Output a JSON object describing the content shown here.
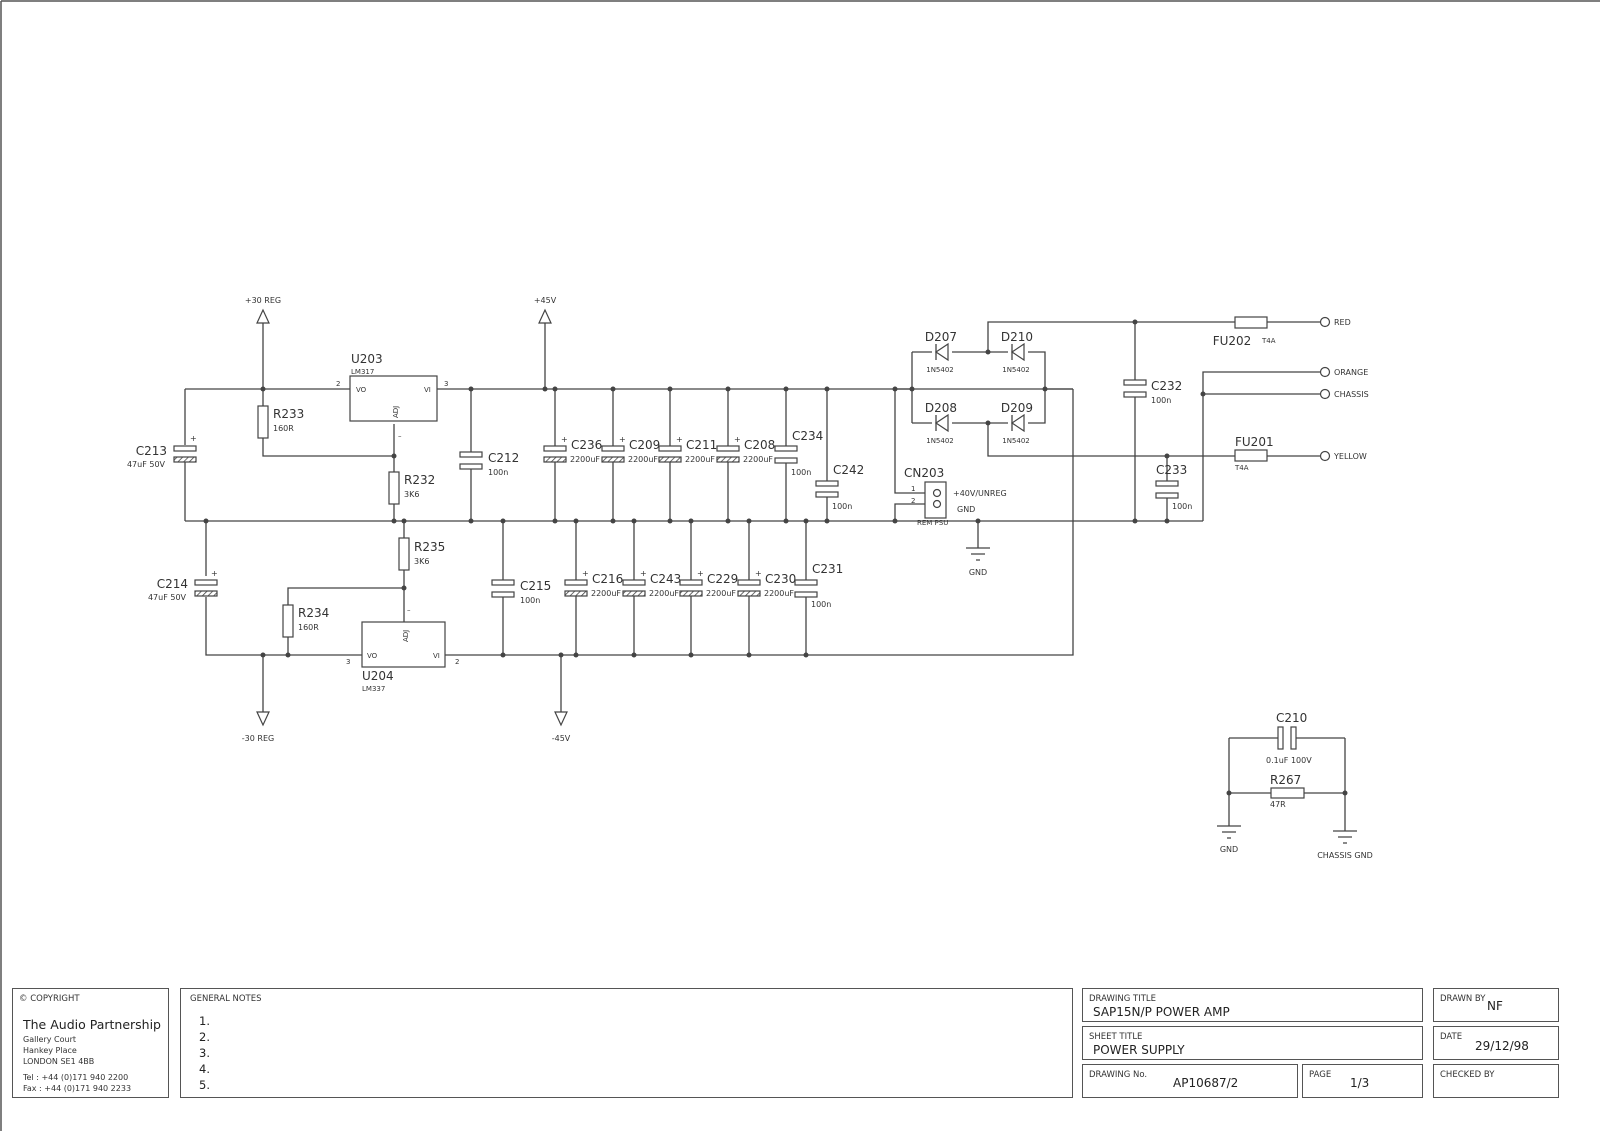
{
  "schematic": {
    "rails": {
      "plus30": "+30 REG",
      "minus30": "-30 REG",
      "plus45": "+45V",
      "minus45": "-45V",
      "gnd": "GND",
      "gnd2": "GND",
      "chassis_gnd": "CHASSIS GND"
    },
    "regulators": [
      {
        "ref": "U203",
        "part": "LM317",
        "vo": "VO",
        "vi": "VI",
        "adj": "ADJ",
        "pin_vo": "2",
        "pin_vi": "3",
        "adj_mark": "–"
      },
      {
        "ref": "U204",
        "part": "LM337",
        "vo": "VO",
        "vi": "VI",
        "adj": "ADJ",
        "pin_vo": "3",
        "pin_vi": "2",
        "adj_mark": "–"
      }
    ],
    "resistors": [
      {
        "ref": "R233",
        "value": "160R"
      },
      {
        "ref": "R232",
        "value": "3K6"
      },
      {
        "ref": "R235",
        "value": "3K6"
      },
      {
        "ref": "R234",
        "value": "160R"
      },
      {
        "ref": "R267",
        "value": "47R"
      }
    ],
    "capacitors_top": [
      {
        "ref": "C213",
        "value": "47uF  50V",
        "polarized": true
      },
      {
        "ref": "C212",
        "value": "100n",
        "polarized": false
      },
      {
        "ref": "C236",
        "value": "2200uF",
        "polarized": true
      },
      {
        "ref": "C209",
        "value": "2200uF",
        "polarized": true
      },
      {
        "ref": "C211",
        "value": "2200uF",
        "polarized": true
      },
      {
        "ref": "C208",
        "value": "2200uF",
        "polarized": true
      },
      {
        "ref": "C234",
        "value": "100n",
        "polarized": false
      },
      {
        "ref": "C242",
        "value": "100n",
        "polarized": false
      }
    ],
    "capacitors_bottom": [
      {
        "ref": "C214",
        "value": "47uF  50V",
        "polarized": true
      },
      {
        "ref": "C215",
        "value": "100n",
        "polarized": false
      },
      {
        "ref": "C216",
        "value": "2200uF",
        "polarized": true
      },
      {
        "ref": "C243",
        "value": "2200uF",
        "polarized": true
      },
      {
        "ref": "C229",
        "value": "2200uF",
        "polarized": true
      },
      {
        "ref": "C230",
        "value": "2200uF",
        "polarized": true
      },
      {
        "ref": "C231",
        "value": "100n",
        "polarized": false
      }
    ],
    "capacitors_input": [
      {
        "ref": "C232",
        "value": "100n"
      },
      {
        "ref": "C233",
        "value": "100n"
      },
      {
        "ref": "C210",
        "value": "0.1uF  100V"
      }
    ],
    "diodes": [
      {
        "ref": "D207",
        "part": "1N5402"
      },
      {
        "ref": "D210",
        "part": "1N5402"
      },
      {
        "ref": "D208",
        "part": "1N5402"
      },
      {
        "ref": "D209",
        "part": "1N5402"
      }
    ],
    "fuses": [
      {
        "ref": "FU202",
        "value": "T4A"
      },
      {
        "ref": "FU201",
        "value": "T4A"
      }
    ],
    "connector": {
      "ref": "CN203",
      "pin1": "1",
      "pin2": "2",
      "pin1_label": "+40V/UNREG",
      "pin2_label": "GND",
      "name": "REM PSU"
    },
    "terminals": [
      "RED",
      "ORANGE",
      "CHASSIS",
      "YELLOW"
    ],
    "plus_sign": "+"
  },
  "titleblock": {
    "copyright_label": "© COPYRIGHT",
    "company": "The Audio Partnership",
    "address": [
      "Gallery Court",
      "Hankey Place",
      "LONDON  SE1 4BB"
    ],
    "tel": "Tel : +44 (0)171 940 2200",
    "fax": "Fax : +44 (0)171 940 2233",
    "notes_label": "GENERAL NOTES",
    "notes": [
      "1.",
      "2.",
      "3.",
      "4.",
      "5."
    ],
    "drawing_title_label": "DRAWING TITLE",
    "drawing_title": "SAP15N/P POWER AMP",
    "sheet_title_label": "SHEET TITLE",
    "sheet_title": "POWER SUPPLY",
    "drawing_no_label": "DRAWING No.",
    "drawing_no": "AP10687/2",
    "page_label": "PAGE",
    "page": "1/3",
    "drawn_by_label": "DRAWN BY",
    "drawn_by": "NF",
    "date_label": "DATE",
    "date": "29/12/98",
    "checked_by_label": "CHECKED BY",
    "checked_by": ""
  }
}
